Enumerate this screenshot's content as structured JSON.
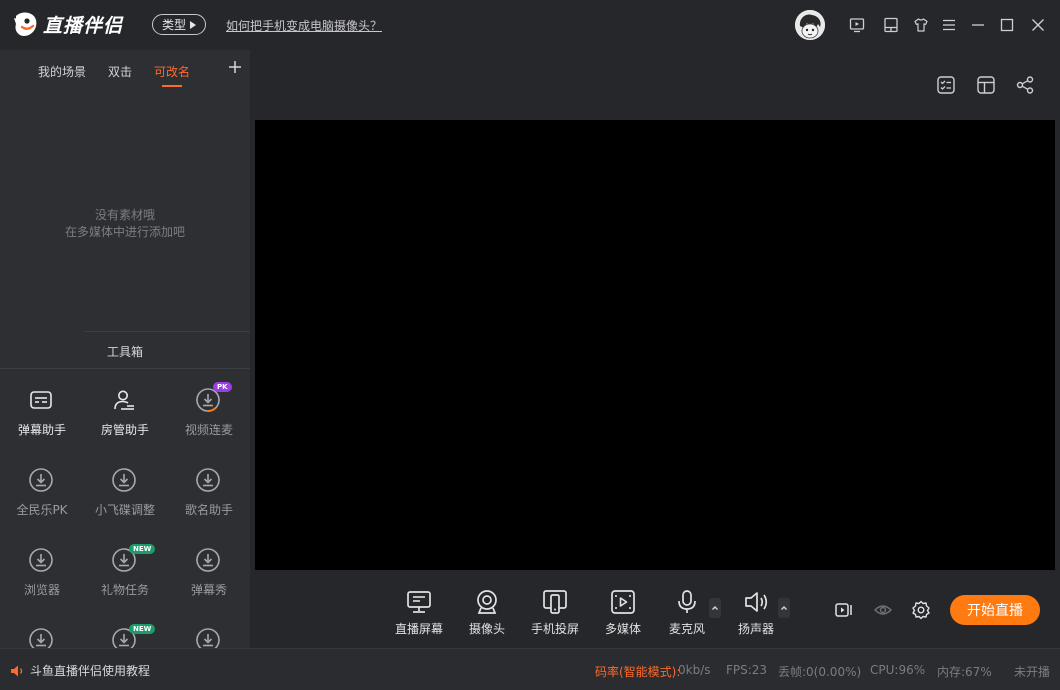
{
  "app": {
    "logo_text": "直播伴侣",
    "type_button": "类型",
    "help_link": "如何把手机变成电脑摄像头？"
  },
  "titlebar_icons": [
    "play-window-icon",
    "screen-mode-icon",
    "skin-tshirt-icon",
    "menu-icon",
    "minimize-icon",
    "maximize-icon",
    "close-icon"
  ],
  "scenes": {
    "tabs": [
      "我的场景",
      "双击",
      "可改名"
    ],
    "active_index": 2,
    "empty_line1": "没有素材哦",
    "empty_line2": "在多媒体中进行添加吧"
  },
  "toolbox": {
    "title": "工具箱",
    "tools": [
      {
        "label": "弹幕助手",
        "icon": "danmaku-icon",
        "enabled": true
      },
      {
        "label": "房管助手",
        "icon": "room-admin-icon",
        "enabled": true
      },
      {
        "label": "视频连麦",
        "icon": "download-icon",
        "enabled": false,
        "badge": "PK"
      },
      {
        "label": "全民乐PK",
        "icon": "download-icon",
        "enabled": false
      },
      {
        "label": "小飞碟调整",
        "icon": "download-icon",
        "enabled": false
      },
      {
        "label": "歌名助手",
        "icon": "download-icon",
        "enabled": false
      },
      {
        "label": "浏览器",
        "icon": "download-icon",
        "enabled": false
      },
      {
        "label": "礼物任务",
        "icon": "download-icon",
        "enabled": false,
        "badge": "NEW"
      },
      {
        "label": "弹幕秀",
        "icon": "download-icon",
        "enabled": false
      },
      {
        "label": "",
        "icon": "download-icon",
        "enabled": false
      },
      {
        "label": "",
        "icon": "download-icon",
        "enabled": false,
        "badge": "NEW"
      },
      {
        "label": "",
        "icon": "download-icon",
        "enabled": false
      }
    ]
  },
  "controls": [
    {
      "label": "直播屏幕",
      "icon": "live-screen-icon"
    },
    {
      "label": "摄像头",
      "icon": "camera-icon"
    },
    {
      "label": "手机投屏",
      "icon": "phone-cast-icon"
    },
    {
      "label": "多媒体",
      "icon": "multimedia-icon"
    },
    {
      "label": "麦克风",
      "icon": "microphone-icon"
    },
    {
      "label": "扬声器",
      "icon": "speaker-icon"
    }
  ],
  "start_button": "开始直播",
  "status": {
    "tutorial": "斗鱼直播伴侣使用教程",
    "bitrate_label": "码率(智能模式):",
    "bitrate_value": "0kb/s",
    "fps": "FPS:23",
    "dropped": "丢帧:0(0.00%)",
    "cpu": "CPU:96%",
    "memory": "内存:67%",
    "live_state": "未开播"
  },
  "colors": {
    "accent": "#ff6a2b",
    "start_button": "#ff7a10",
    "background": "#26272b",
    "panel": "#2e2f33"
  }
}
